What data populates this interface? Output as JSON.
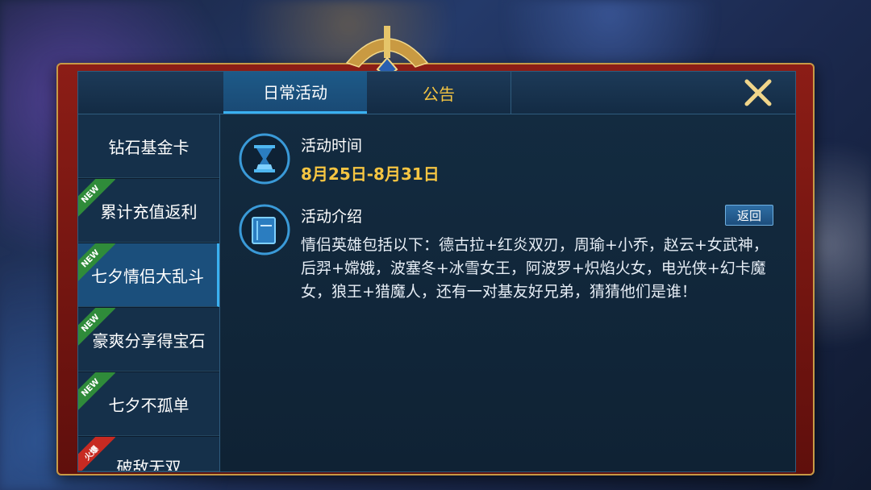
{
  "tabs": {
    "active": "日常活动",
    "notice": "公告"
  },
  "sidebar": {
    "items": [
      {
        "label": "钻石基金卡",
        "badge": ""
      },
      {
        "label": "累计充值返利",
        "badge": "NEW"
      },
      {
        "label": "七夕情侣大乱斗",
        "badge": "NEW"
      },
      {
        "label": "豪爽分享得宝石",
        "badge": "NEW"
      },
      {
        "label": "七夕不孤单",
        "badge": "NEW"
      },
      {
        "label": "破敌无双",
        "badge": "火爆"
      }
    ]
  },
  "content": {
    "time_label": "活动时间",
    "time_value": "8月25日-8月31日",
    "intro_label": "活动介绍",
    "back_label": "返回",
    "description": "情侣英雄包括以下：德古拉+红炎双刃，周瑜+小乔，赵云+女武神，后羿+嫦娥，波塞冬+冰雪女王，阿波罗+炽焰火女，电光侠+幻卡魔女，狼王+猎魔人，还有一对基友好兄弟，猜猜他们是谁！"
  },
  "icons": {
    "close": "close-icon",
    "time": "hourglass-icon",
    "intro": "book-icon"
  },
  "colors": {
    "gold": "#f5c542",
    "accent": "#3ab0f0",
    "panel": "#13283d"
  }
}
